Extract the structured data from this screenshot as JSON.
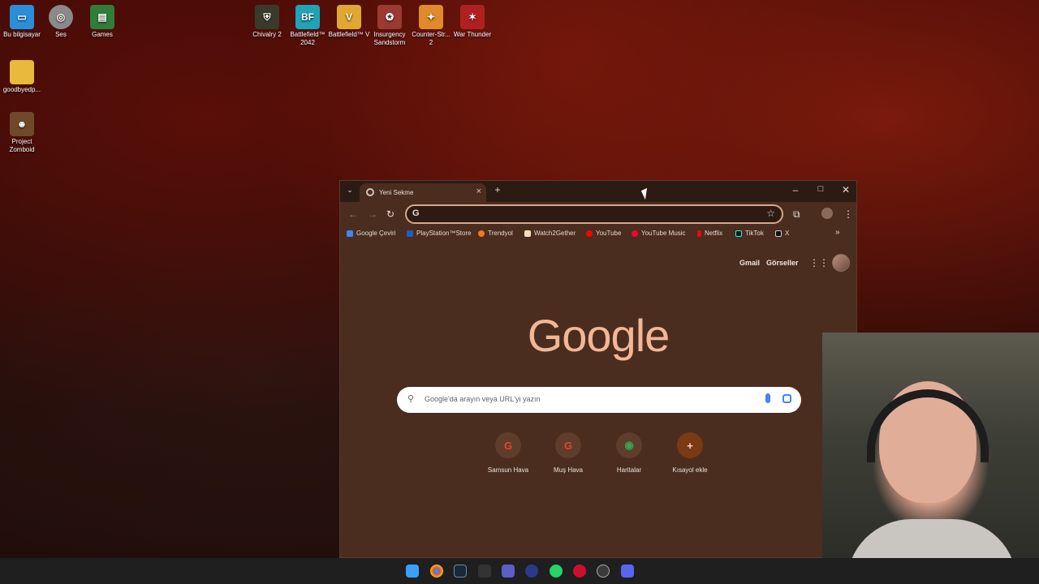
{
  "desktop": {
    "icons": [
      {
        "label": "Bu bilgisayar",
        "color": "#2a8fd8",
        "glyph": "▭"
      },
      {
        "label": "Ses",
        "color": "#8a8a8a",
        "glyph": "◎"
      },
      {
        "label": "Games",
        "color": "#2f7d3a",
        "glyph": "▤"
      },
      {
        "label": "goodbyedp...",
        "color": "#e8b93c",
        "glyph": ""
      },
      {
        "label": "Project Zomboid",
        "color": "#6e4a2a",
        "glyph": "☻"
      },
      {
        "label": "Chivalry 2",
        "color": "#3a3a2a",
        "glyph": "⛨"
      },
      {
        "label": "Battlefield™ 2042",
        "color": "#1fa3b8",
        "glyph": "BF"
      },
      {
        "label": "Battlefield™ V",
        "color": "#e0a830",
        "glyph": "V"
      },
      {
        "label": "Insurgency Sandstorm",
        "color": "#9a3a32",
        "glyph": "✪"
      },
      {
        "label": "Counter-Str... 2",
        "color": "#e08a2a",
        "glyph": "✦"
      },
      {
        "label": "War Thunder",
        "color": "#b02020",
        "glyph": "✶"
      }
    ]
  },
  "browser": {
    "tab_title": "Yeni Sekme",
    "new_tab_glyph": "+",
    "omnibox_value": "",
    "bookmarks": [
      {
        "label": "Google Çeviri",
        "color": "#4285f4"
      },
      {
        "label": "PlayStation™Store",
        "color": "#1f5fbf"
      },
      {
        "label": "Trendyol",
        "color": "#f27a1a"
      },
      {
        "label": "Watch2Gether",
        "color": "#f0e0c0"
      },
      {
        "label": "YouTube",
        "color": "#ff0000"
      },
      {
        "label": "YouTube Music",
        "color": "#ff0033"
      },
      {
        "label": "Netflix",
        "color": "#e50914"
      },
      {
        "label": "TikTok",
        "color": "#111111"
      },
      {
        "label": "X",
        "color": "#111111"
      }
    ],
    "bookmarks_overflow": "»",
    "ntp": {
      "gmail_label": "Gmail",
      "images_label": "Görseller",
      "logo_text": "Google",
      "search_placeholder": "Google'da arayın veya URL'yi yazın",
      "shortcuts": [
        {
          "label": "Samsun Hava",
          "glyph": "G",
          "color": "#ea4335"
        },
        {
          "label": "Muş Hava",
          "glyph": "G",
          "color": "#ea4335"
        },
        {
          "label": "Haritalar",
          "glyph": "◉",
          "color": "#34a853"
        },
        {
          "label": "Kısayol ekle",
          "glyph": "+",
          "color": "#f2d6c8"
        }
      ]
    }
  },
  "taskbar": {
    "apps": [
      {
        "name": "start-icon",
        "color": "#3aa0ff"
      },
      {
        "name": "chrome-icon",
        "color": "#ea4335"
      },
      {
        "name": "steam-icon",
        "color": "#1b2838"
      },
      {
        "name": "epic-games-icon",
        "color": "#333333"
      },
      {
        "name": "teams-icon",
        "color": "#5b5fc7"
      },
      {
        "name": "ea-app-icon",
        "color": "#2a3a8a"
      },
      {
        "name": "whatsapp-icon",
        "color": "#25d366"
      },
      {
        "name": "opera-gx-icon",
        "color": "#cc0f2f"
      },
      {
        "name": "obs-icon",
        "color": "#3a3a3a"
      },
      {
        "name": "discord-icon",
        "color": "#5865f2"
      }
    ]
  }
}
